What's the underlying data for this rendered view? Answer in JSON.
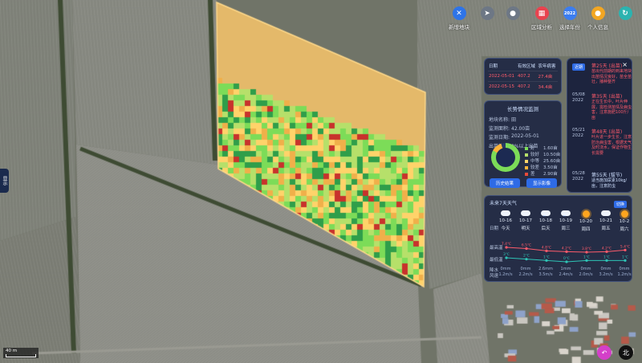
{
  "toolbar": [
    {
      "label": "新增地块",
      "icon": "scissors-icon",
      "color": "#2e74e8",
      "glyph": "✕"
    },
    {
      "label": "",
      "icon": "locate-icon",
      "color": "#6d7785",
      "glyph": "➤"
    },
    {
      "label": "",
      "icon": "pin-icon",
      "color": "#6d7785",
      "glyph": "●"
    },
    {
      "label": "区域分析",
      "icon": "grid-icon",
      "color": "#e8434f",
      "glyph": "▦"
    },
    {
      "label": "选择年份",
      "icon": "year-icon",
      "color": "#3b7df0",
      "glyph": "2022"
    },
    {
      "label": "个人信息",
      "icon": "user-icon",
      "color": "#f2a623",
      "glyph": "●"
    },
    {
      "label": "",
      "icon": "refresh-icon",
      "color": "#2bb3b0",
      "glyph": "↻"
    }
  ],
  "history_table": {
    "headers": [
      "日期",
      "有效区域",
      "农年病害"
    ],
    "rows": [
      [
        "2022-05-01",
        "407.2",
        "27.4亩"
      ],
      [
        "2022-05-15",
        "407.2",
        "34.4亩"
      ]
    ]
  },
  "monitor": {
    "title": "长势情况监测",
    "fields": [
      {
        "k": "地块名称:",
        "v": "田"
      },
      {
        "k": "监测面积:",
        "v": "42.00亩"
      },
      {
        "k": "监测日期:",
        "v": "2022-05-01"
      },
      {
        "k": "出苗情况:",
        "v": "0%以上出苗"
      }
    ],
    "legend": [
      {
        "c": "#7cdc58",
        "t": "好",
        "v": "1.60亩"
      },
      {
        "c": "#b6e06a",
        "t": "较好",
        "v": "10.50亩"
      },
      {
        "c": "#ffd36a",
        "t": "中等",
        "v": "25.60亩"
      },
      {
        "c": "#ffb33a",
        "t": "较差",
        "v": "3.50亩"
      },
      {
        "c": "#e84a3a",
        "t": "差",
        "v": "2.90亩"
      }
    ],
    "btn_history": "历史结果",
    "btn_show": "显示影像"
  },
  "timeline": {
    "badge": "近期",
    "close": "×",
    "items": [
      {
        "date": "",
        "head": "第25天 (出苗)",
        "text": "苗出代前期的到来地块出苗情况良好，苗全苗壮，播种整齐",
        "color": "#ff5b6b"
      },
      {
        "date": "05/08\n2022",
        "head": "第35天 (出苗)",
        "text": "正在生长中，叶片伸展，需检测苗情及病虫害，注意施肥100斤/亩",
        "color": "#ff5b6b"
      },
      {
        "date": "05/21\n2022",
        "head": "第48天 (出苗)",
        "text": "叶片进一步生长，注意防治病虫害，根据天气及时浇水，保证作物生长需要",
        "color": "#ff5b6b"
      },
      {
        "date": "05/28\n2022",
        "head": "第55天 (拔节)",
        "text": "适当施加尿素10kg/亩，注意防虫",
        "color": "#cfe0ff"
      }
    ]
  },
  "weather": {
    "title": "未来7天天气",
    "badge": "切换",
    "row_label_date": "日期",
    "row_label_high": "最高温",
    "row_label_low": "最低温",
    "row_label_wind": "降水\n风速",
    "days": [
      {
        "icon": "cloud-icon",
        "date": "10-16",
        "wk": "今天",
        "high": "7.4℃",
        "low": "3℃",
        "wind": "0mm\n1.2m/s"
      },
      {
        "icon": "cloud-icon",
        "date": "10-17",
        "wk": "明天",
        "high": "6.5℃",
        "low": "2℃",
        "wind": "0mm\n2.2m/s"
      },
      {
        "icon": "rain-icon",
        "date": "10-18",
        "wk": "后天",
        "high": "4.8℃",
        "low": "1℃",
        "wind": "2.6mm\n3.5m/s"
      },
      {
        "icon": "rain-icon",
        "date": "10-19",
        "wk": "周三",
        "high": "4.2℃",
        "low": "0℃",
        "wind": "1mm\n2.4m/s"
      },
      {
        "icon": "sun-icon",
        "date": "10-20",
        "wk": "周四",
        "high": "3.8℃",
        "low": "1℃",
        "wind": "0mm\n2.0m/s"
      },
      {
        "icon": "cloud-icon",
        "date": "10-21",
        "wk": "周五",
        "high": "4.2℃",
        "low": "1℃",
        "wind": "0mm\n3.2m/s"
      },
      {
        "icon": "sun-icon",
        "date": "10-2",
        "wk": "周六",
        "high": "5.4℃",
        "low": "1℃",
        "wind": "0mm\n1.2m/s"
      }
    ],
    "high_series": [
      7.4,
      6.5,
      4.8,
      4.2,
      3.8,
      4.2,
      5.4
    ],
    "low_series": [
      3,
      2,
      1,
      0,
      1,
      1,
      1
    ]
  },
  "side_tab": "显示",
  "scale_text": "40 m",
  "north_label": "北",
  "back_glyph": "↶",
  "colors": {
    "field_fill": "#e4b96a",
    "field_border": "#ffd98a",
    "panel": "#182240",
    "accent": "#2e6be6"
  }
}
